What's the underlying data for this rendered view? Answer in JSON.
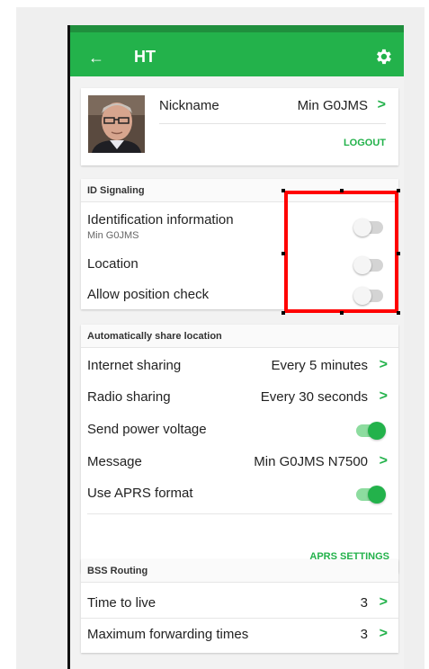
{
  "appbar": {
    "title": "HT",
    "back_icon": "arrow-left-icon",
    "settings_icon": "gear-icon",
    "color": "#23b24b"
  },
  "profile": {
    "nickname_label": "Nickname",
    "nickname_value": "Min G0JMS",
    "chevron": ">",
    "logout_label": "LOGOUT"
  },
  "id_signaling": {
    "title": "ID Signaling",
    "items": [
      {
        "label": "Identification information",
        "sublabel": "Min G0JMS",
        "enabled": false
      },
      {
        "label": "Location",
        "enabled": false
      },
      {
        "label": "Allow position check",
        "enabled": false
      }
    ]
  },
  "share_location": {
    "title": "Automatically share location",
    "internet_label": "Internet sharing",
    "internet_value": "Every 5 minutes",
    "radio_label": "Radio sharing",
    "radio_value": "Every 30 seconds",
    "power_label": "Send power voltage",
    "power_enabled": true,
    "message_label": "Message",
    "message_value": "Min G0JMS N7500",
    "aprs_label": "Use APRS format",
    "aprs_enabled": true,
    "aprs_settings_label": "APRS SETTINGS"
  },
  "bss_routing": {
    "title": "BSS Routing",
    "ttl_label": "Time to live",
    "ttl_value": "3",
    "max_fwd_label": "Maximum forwarding times",
    "max_fwd_value": "3"
  },
  "colors": {
    "accent": "#23b24b",
    "highlight": "#ff0000"
  }
}
